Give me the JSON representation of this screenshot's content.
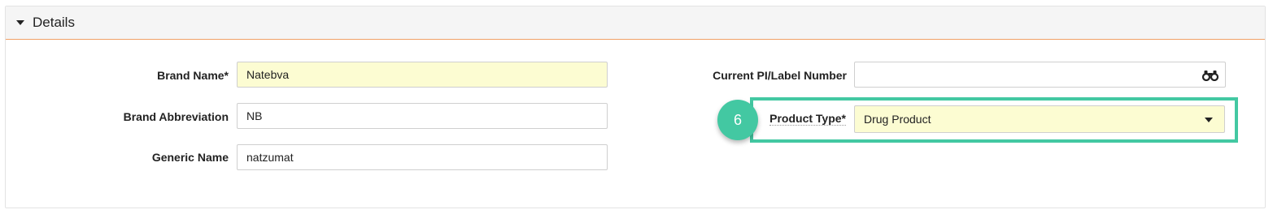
{
  "panel": {
    "title": "Details"
  },
  "fields": {
    "brand_name": {
      "label": "Brand Name*",
      "value": "Natebva"
    },
    "brand_abbreviation": {
      "label": "Brand Abbreviation",
      "value": "NB"
    },
    "generic_name": {
      "label": "Generic Name",
      "value": "natzumat"
    },
    "current_pi_label_number": {
      "label": "Current PI/Label Number",
      "value": "",
      "icon": "binoculars-icon"
    },
    "product_type": {
      "label": "Product Type*",
      "value": "Drug Product"
    }
  },
  "annotation": {
    "step": "6",
    "color": "#43c8a2"
  },
  "colors": {
    "required_field_bg": "#fcfcd2",
    "header_border": "#f0a066"
  }
}
